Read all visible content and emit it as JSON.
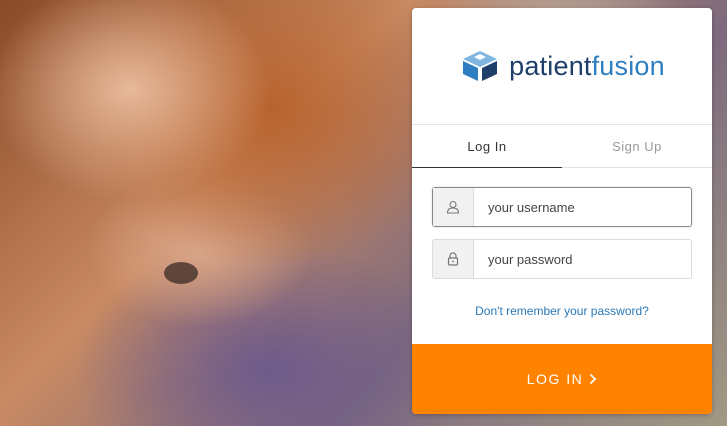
{
  "brand": {
    "name_part1": "patient",
    "name_part2": "fusion",
    "logo_icon": "cube-icon",
    "colors": {
      "dark_blue": "#1f3f6b",
      "light_blue": "#2d7fc1"
    }
  },
  "tabs": [
    {
      "label": "Log In",
      "active": true
    },
    {
      "label": "Sign Up",
      "active": false
    }
  ],
  "form": {
    "username": {
      "placeholder": "your username",
      "value": "",
      "icon": "user-icon"
    },
    "password": {
      "placeholder": "your password",
      "value": "",
      "icon": "lock-icon"
    },
    "forgot_link": "Don't remember your password?",
    "submit_label": "LOG IN",
    "submit_color": "#ff8200"
  }
}
